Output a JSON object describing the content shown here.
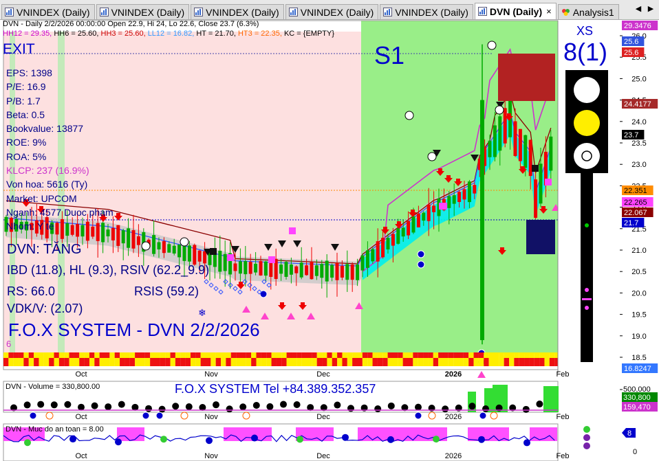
{
  "tabs": [
    {
      "label": "VNINDEX (Daily)",
      "active": false
    },
    {
      "label": "VNINDEX (Daily)",
      "active": false
    },
    {
      "label": "VNINDEX (Daily)",
      "active": false
    },
    {
      "label": "VNINDEX (Daily)",
      "active": false
    },
    {
      "label": "VNINDEX (Daily)",
      "active": false
    },
    {
      "label": "DVN (Daily)",
      "active": true,
      "close": "×"
    },
    {
      "label": "Analysis1",
      "active": false
    }
  ],
  "nav": {
    "left": "◀",
    "right": "▶"
  },
  "header": {
    "line1": "DVN - Daily 2/2/2026 00:00:00 Open 22.9, Hi 24, Lo 22.6, Close 23.7 (6.3%)",
    "line2": [
      {
        "text": "HH12 = 29.35, ",
        "color": "#cc00cc"
      },
      {
        "text": "HH6 = 25.60, ",
        "color": "#000000"
      },
      {
        "text": "HH3 = 25.60, ",
        "color": "#cc0000"
      },
      {
        "text": "LL12 = 16.82, ",
        "color": "#3399ff"
      },
      {
        "text": "HT = 21.70, ",
        "color": "#000000"
      },
      {
        "text": "HT3 = 22.35, ",
        "color": "#ff6600"
      },
      {
        "text": "KC = {EMPTY}",
        "color": "#000000"
      }
    ]
  },
  "overlay": {
    "exit": "EXIT",
    "s1": "S1",
    "fundamentals": [
      "EPS: 1398",
      "P/E: 16.9",
      "P/B: 1.7",
      "Beta: 0.5",
      "Bookvalue: 13877",
      "ROE: 9%",
      "ROA: 5%",
      "KLCP: 237 (16.9%)",
      "Von hoa: 5616 (Ty)",
      "Market: UPCOM",
      "Nganh: 4577 Duoc pham",
      "Nhom: Y te"
    ],
    "signal": "DVN: TĂNG",
    "ibd": "IBD (11.8), HL (9.3), RSIV (62.2_9.9)",
    "rs": "RS: 66.0",
    "rsis": "RSIS (59.2)",
    "vdk": "VDK/V:  (2.07)",
    "fox": "F.O.X SYSTEM - DVN 2/2/2026",
    "six": "6",
    "xs_label": "XS",
    "xs_value": "8(1)",
    "tel": "F.O.X SYSTEM Tel +84.389.352.357"
  },
  "price_axis": {
    "ticks": [
      "26.0",
      "25.5",
      "25.0",
      "24.5",
      "24.0",
      "23.5",
      "23.0",
      "22.5",
      "22.0",
      "21.5",
      "21.0",
      "20.5",
      "20.0",
      "19.5",
      "19.0",
      "18.5"
    ],
    "labels": [
      {
        "text": "29.3476",
        "bg": "#cc33cc",
        "fg": "#ffffff"
      },
      {
        "text": "25.6",
        "bg": "#3355dd",
        "fg": "#ffffff"
      },
      {
        "text": "25.6",
        "bg": "#dd2222",
        "fg": "#ffffff"
      },
      {
        "text": "24.4177",
        "bg": "#a52a2a",
        "fg": "#ffffff"
      },
      {
        "text": "23.7",
        "bg": "#000000",
        "fg": "#ffffff"
      },
      {
        "text": "22.351",
        "bg": "#ff8c00",
        "fg": "#000000"
      },
      {
        "text": "22.265",
        "bg": "#ff44ff",
        "fg": "#000000"
      },
      {
        "text": "22.067",
        "bg": "#8b0000",
        "fg": "#ffffff"
      },
      {
        "text": "21.7",
        "bg": "#0000cc",
        "fg": "#ffffff"
      },
      {
        "text": "16.8247",
        "bg": "#3377ff",
        "fg": "#ffffff"
      }
    ]
  },
  "months": [
    "Oct",
    "Nov",
    "Dec",
    "2026",
    "Feb"
  ],
  "volume": {
    "title": "DVN - Volume = 330,800.00",
    "ticks": [
      "500,000"
    ],
    "labels": [
      {
        "text": "330,800",
        "bg": "#008800",
        "fg": "#ffffff"
      },
      {
        "text": "159,470",
        "bg": "#cc33cc",
        "fg": "#ffffff"
      }
    ]
  },
  "safety": {
    "title": "DVN - Muc do an toan = 8.00",
    "ticks": [
      "0"
    ],
    "label": "8"
  },
  "colors": {
    "bull": "#00aa00",
    "bear": "#ee0000",
    "pink_zone": "#fde0e0",
    "green_zone": "#99ee88",
    "cyan": "#00eeee",
    "magenta": "#cc33cc"
  }
}
